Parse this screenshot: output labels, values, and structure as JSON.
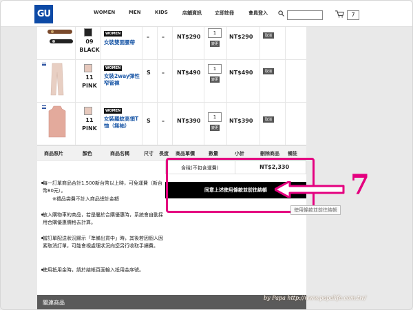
{
  "header": {
    "logo_text": "GU",
    "nav": [
      "WOMEN",
      "MEN",
      "KIDS",
      "店舖資訊",
      "立即註冊",
      "會員登入"
    ],
    "cart_count": "7"
  },
  "rows": [
    {
      "size_num": "09",
      "color": "BLACK",
      "badge": "WOMEN",
      "name": "女裝雙面腰帶",
      "size": "–",
      "length": "–",
      "price": "NT$290",
      "qty": "1",
      "update": "變更",
      "subtotal": "NT$290",
      "delete": "取消"
    },
    {
      "size_num": "11",
      "color": "PINK",
      "badge": "WOMEN",
      "name": "女裝2way彈性窄管褲",
      "size": "S",
      "length": "–",
      "price": "NT$490",
      "qty": "1",
      "update": "變更",
      "subtotal": "NT$490",
      "delete": "取消"
    },
    {
      "size_num": "11",
      "color": "PINK",
      "badge": "WOMEN",
      "name": "女裝羅紋高領T恤（無袖）",
      "size": "S",
      "length": "–",
      "price": "NT$390",
      "qty": "1",
      "update": "變更",
      "subtotal": "NT$390",
      "delete": "取消"
    }
  ],
  "table_header": [
    "商品照片",
    "顏色",
    "商品名稱",
    "尺寸",
    "長度",
    "商品單價",
    "數量",
    "小計",
    "刪除商品",
    "備註"
  ],
  "notes": [
    "每一訂單商品合計1,500新台幣以上時，可免運費（新台幣80元）。",
    "※禮品袋費不計入商品總計金額",
    "放入購物車的商品，若是屬於合購優惠時，系統會自動採用合購優惠價格去計算。",
    "當訂單配送狀況顯示「準備出貨中」時，其後若因個人因素取消訂單，可能會視處理狀況向您另行收取手續費。",
    "使用抵用金時，請於結帳頁面輸入抵用金序號。"
  ],
  "summary": {
    "label": "含稅(不包含運費)",
    "total": "NT$2,330"
  },
  "checkout_label": "同意上述使用條款並前往結帳",
  "tooltip": "使用條款並前往結帳",
  "related_label": "關連商品",
  "annotation": {
    "step": "7",
    "color": "#e4007f"
  },
  "watermark": "by Papa   http://www.papalife.com.tw/"
}
